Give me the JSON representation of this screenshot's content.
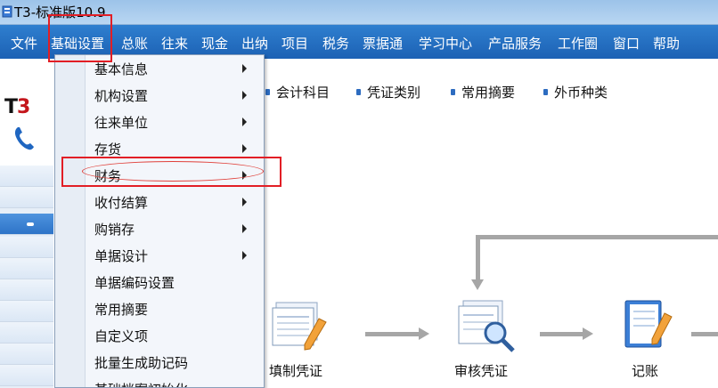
{
  "window": {
    "title": "T3-标准版10.9"
  },
  "menubar": {
    "items": [
      "文件",
      "基础设置",
      "总账",
      "往来",
      "现金",
      "出纳",
      "项目",
      "税务",
      "票据通",
      "学习中心",
      "产品服务",
      "工作圈",
      "窗口",
      "帮助"
    ]
  },
  "dropdown": {
    "items": [
      {
        "label": "基本信息",
        "submenu": true
      },
      {
        "label": "机构设置",
        "submenu": true
      },
      {
        "label": "往来单位",
        "submenu": true
      },
      {
        "label": "存货",
        "submenu": true
      },
      {
        "label": "财务",
        "submenu": true
      },
      {
        "label": "收付结算",
        "submenu": true
      },
      {
        "label": "购销存",
        "submenu": true
      },
      {
        "label": "单据设计",
        "submenu": true
      },
      {
        "label": "单据编码设置",
        "submenu": false
      },
      {
        "label": "常用摘要",
        "submenu": false
      },
      {
        "label": "自定义项",
        "submenu": false
      },
      {
        "label": "批量生成助记码",
        "submenu": false
      },
      {
        "label": "基础档案初始化",
        "submenu": false
      }
    ]
  },
  "logo": {
    "t": "T",
    "three": "3"
  },
  "toolbar": {
    "links": [
      "会计科目",
      "凭证类别",
      "常用摘要",
      "外币种类"
    ]
  },
  "flow": {
    "steps": [
      "填制凭证",
      "审核凭证",
      "记账"
    ]
  },
  "colors": {
    "menubar": "#2367bb",
    "annotation_red": "#e21e25",
    "flow_line": "#a6a6a6"
  }
}
